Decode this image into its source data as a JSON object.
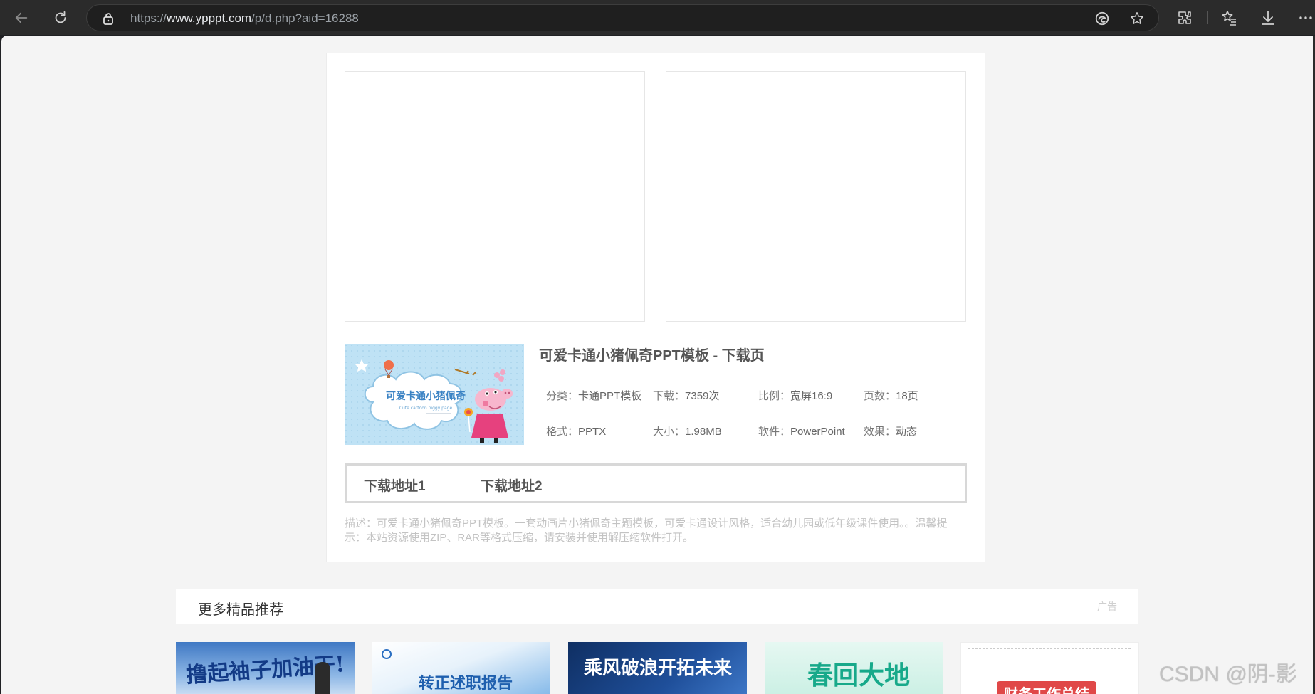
{
  "browser": {
    "url_scheme": "https://",
    "url_host": "www.ypppt.com",
    "url_path": "/p/d.php?aid=16288",
    "icons": [
      "back-icon",
      "refresh-icon",
      "lock-icon",
      "edge-icon",
      "favorite-star-icon",
      "extensions-icon",
      "favorites-list-icon",
      "download-icon",
      "more-icon"
    ]
  },
  "page": {
    "title": "可爱卡通小猪佩奇PPT模板 - 下载页",
    "thumbnail": {
      "title_cn": "可爱卡通小猪佩奇",
      "title_en": "Cute cartoon piggy page"
    },
    "meta": {
      "category_label": "分类：",
      "category_value": "卡通PPT模板",
      "downloads_label": "下载：",
      "downloads_value": "7359次",
      "ratio_label": "比例：",
      "ratio_value": "宽屏16:9",
      "pages_label": "页数：",
      "pages_value": "18页",
      "format_label": "格式：",
      "format_value": "PPTX",
      "size_label": "大小：",
      "size_value": "1.98MB",
      "software_label": "软件：",
      "software_value": "PowerPoint",
      "effect_label": "效果：",
      "effect_value": "动态"
    },
    "download_links": [
      "下载地址1",
      "下载地址2"
    ],
    "description": "描述：可爱卡通小猪佩奇PPT模板。一套动画片小猪佩奇主题模板，可爱卡通设计风格，适合幼儿园或低年级课件使用。。温馨提示：本站资源使用ZIP、RAR等格式压缩，请安装并使用解压缩软件打开。"
  },
  "recommend": {
    "title": "更多精品推荐",
    "ad_label": "广告",
    "items": [
      {
        "caption": "撸起袖子加油干!"
      },
      {
        "caption": "转正述职报告"
      },
      {
        "caption": "乘风破浪开拓未来"
      },
      {
        "caption": "春回大地"
      },
      {
        "caption": "财务工作总结"
      }
    ]
  },
  "watermark": "CSDN @阴-影",
  "colors": {
    "chrome_bg": "#2b2b2b",
    "page_bg": "#f4f4f4",
    "card_bg": "#ffffff",
    "title_text": "#555555",
    "desc_text": "#c3c3c3"
  }
}
